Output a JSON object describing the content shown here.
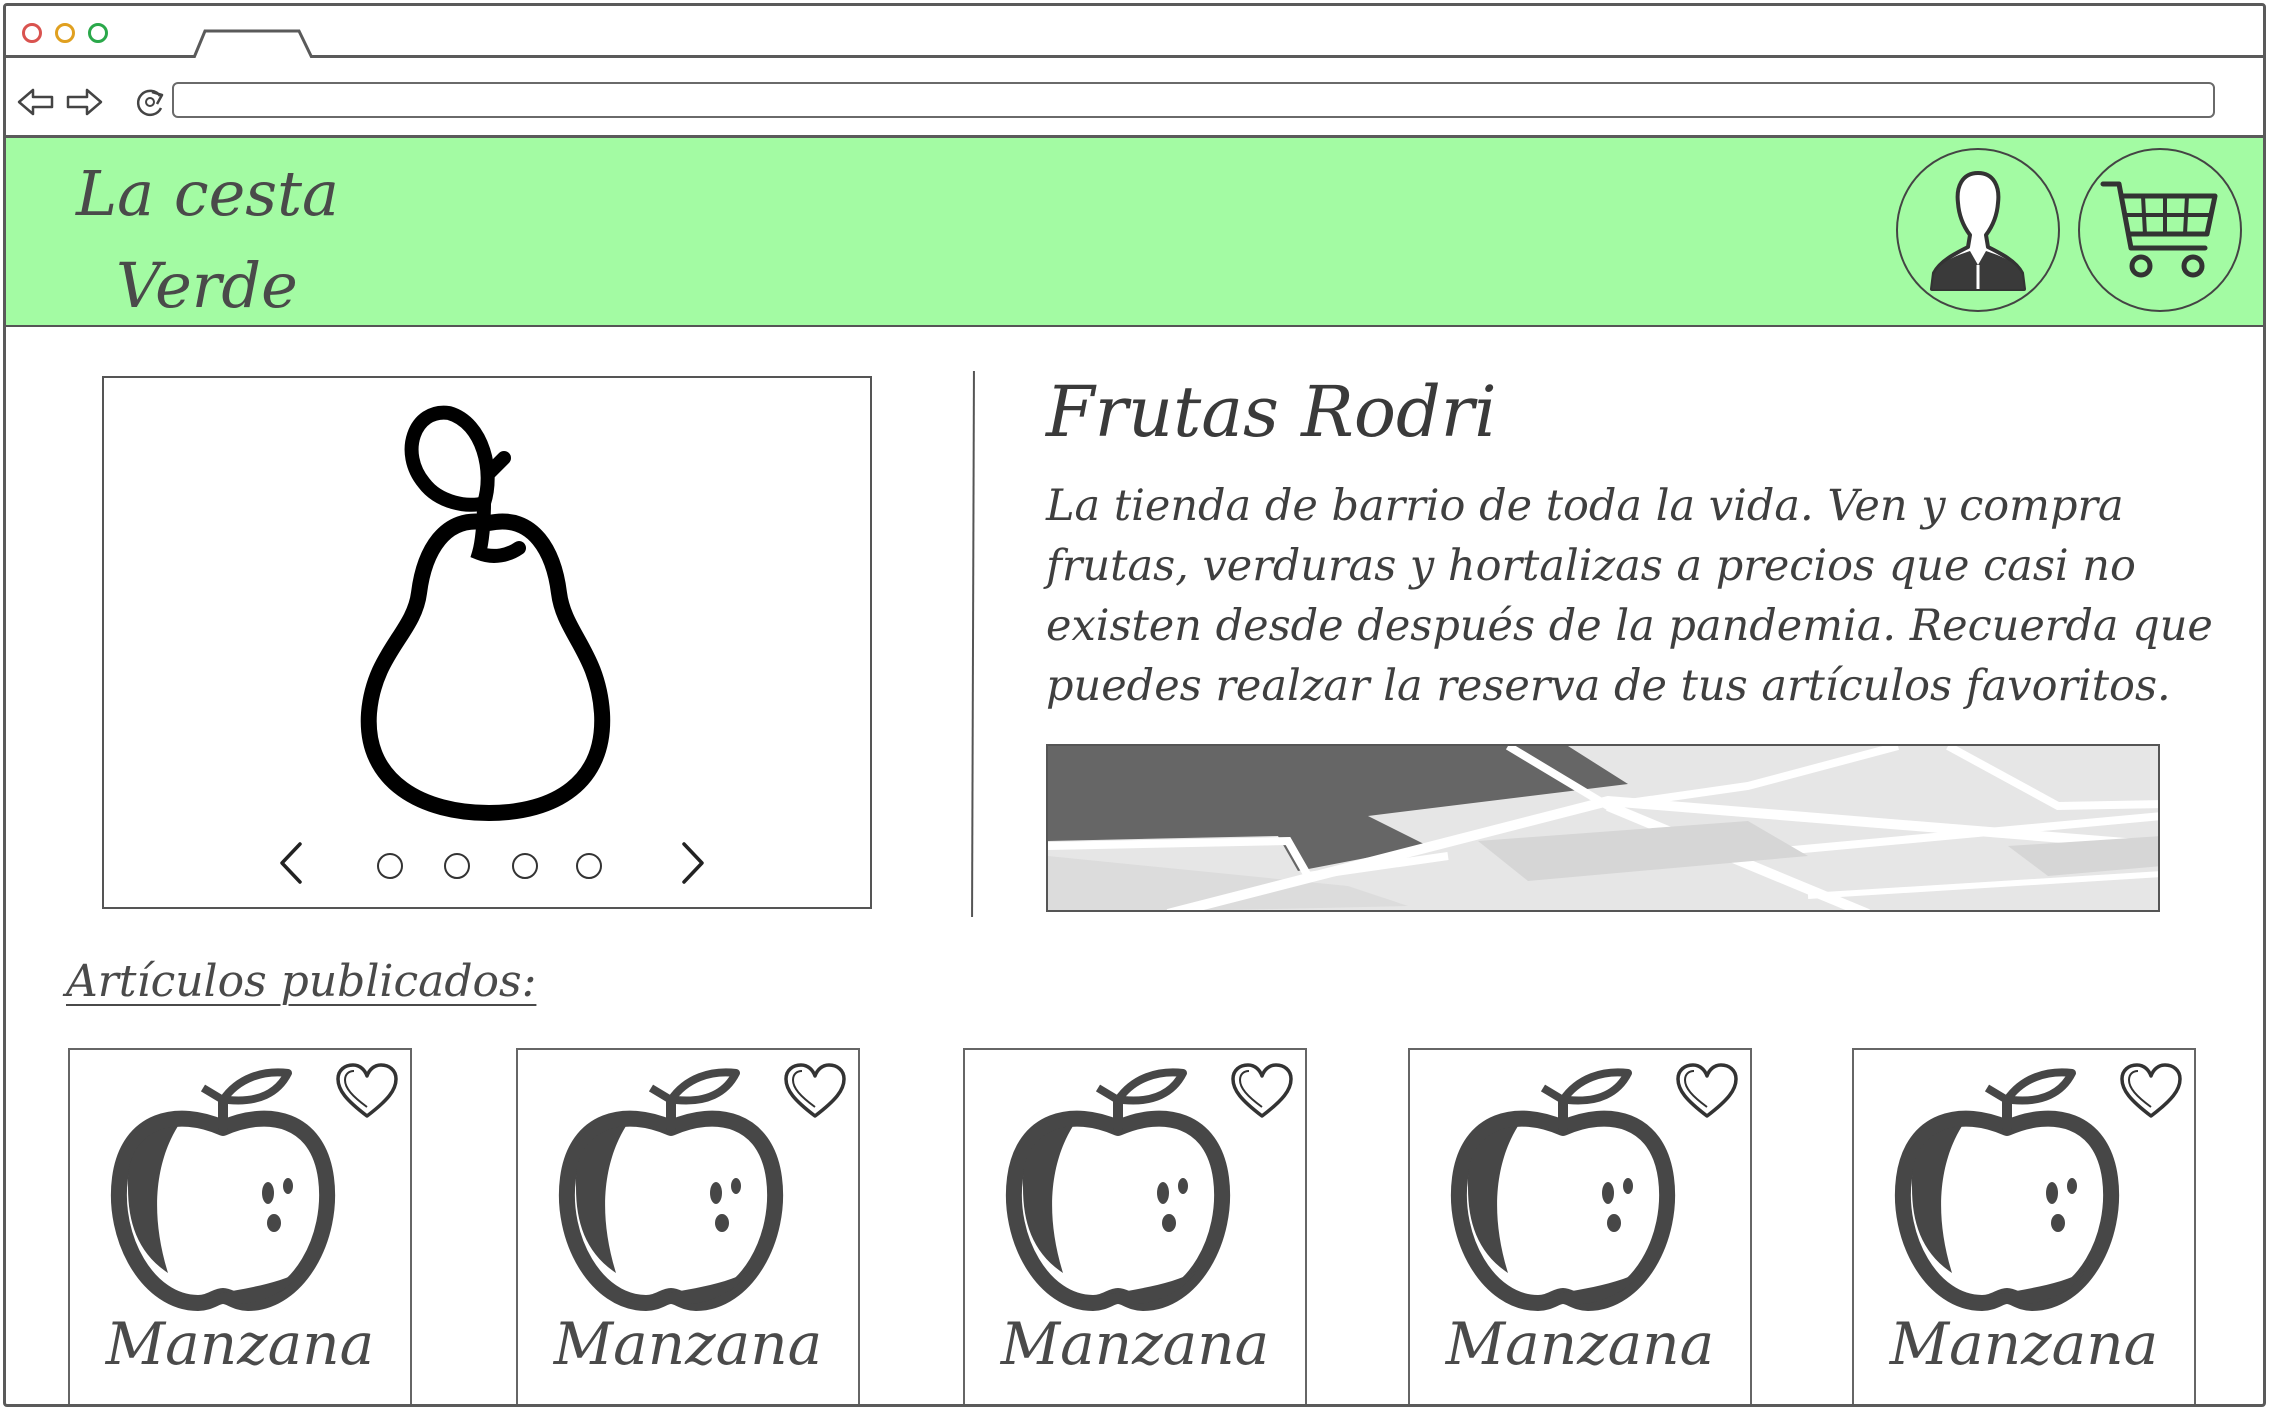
{
  "browser": {
    "window_controls": [
      "close",
      "minimize",
      "maximize"
    ],
    "nav": {
      "back_icon": "arrow-left-icon",
      "forward_icon": "arrow-right-icon",
      "reload_icon": "reload-icon"
    },
    "url": ""
  },
  "header": {
    "logo_line1": "La cesta",
    "logo_line2": "Verde",
    "background": "#a3fba3",
    "account_icon": "user-icon",
    "cart_icon": "shopping-cart-icon"
  },
  "carousel": {
    "image_icon": "pear-icon",
    "slide_count": 4,
    "prev_icon": "chevron-left-icon",
    "next_icon": "chevron-right-icon"
  },
  "shop": {
    "title": "Frutas Rodri",
    "description": "La tienda de barrio de toda la vida. Ven y compra frutas, verduras y hortalizas a precios que casi no existen desde después de la pandemia. Recuerda que puedes realzar la reserva de tus artículos favoritos.",
    "map_icon": "map-icon"
  },
  "articles": {
    "label": "Artículos publicados:",
    "items": [
      {
        "name": "Manzana",
        "icon": "apple-icon",
        "favorite_icon": "heart-icon"
      },
      {
        "name": "Manzana",
        "icon": "apple-icon",
        "favorite_icon": "heart-icon"
      },
      {
        "name": "Manzana",
        "icon": "apple-icon",
        "favorite_icon": "heart-icon"
      },
      {
        "name": "Manzana",
        "icon": "apple-icon",
        "favorite_icon": "heart-icon"
      },
      {
        "name": "Manzana",
        "icon": "apple-icon",
        "favorite_icon": "heart-icon"
      }
    ]
  }
}
